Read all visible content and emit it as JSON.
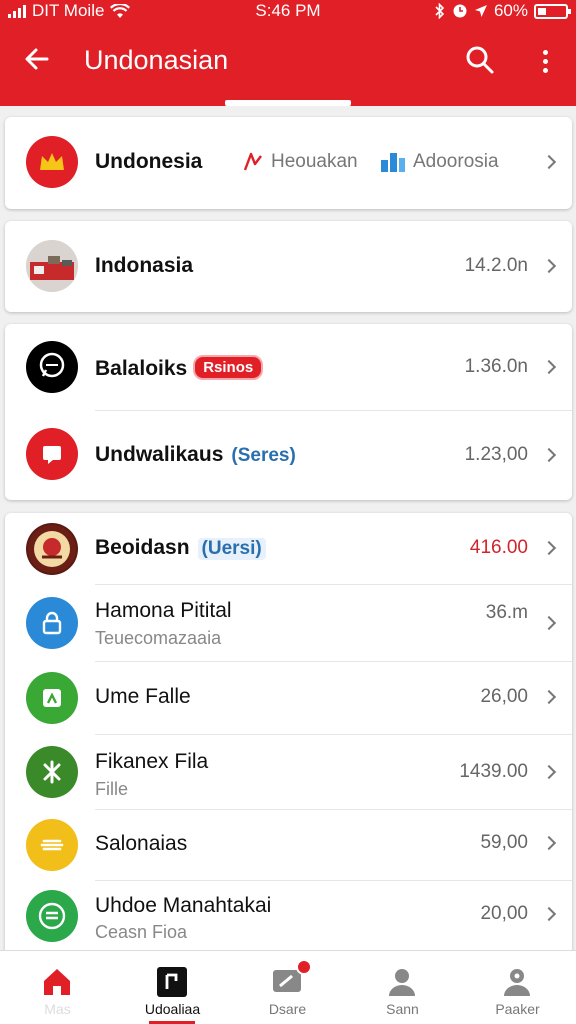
{
  "status": {
    "carrier": "DIT Moile",
    "time": "S:46 PM",
    "battery": "60%"
  },
  "appbar": {
    "title": "Undonasian"
  },
  "colors": {
    "primary": "#e01f27",
    "accent_blue": "#2b6fae",
    "price_red": "#d0242b"
  },
  "header_card": {
    "name": "Undonesia",
    "link1": "Heouakan",
    "link2": "Adoorosia"
  },
  "card1": {
    "name": "Indonasia",
    "value": "14.2.0n"
  },
  "card2": {
    "rows": [
      {
        "name": "Balaloiks",
        "pill": "Rsinos",
        "value": "1.36.0n"
      },
      {
        "name": "Undwalikaus",
        "tag": "(Seres)",
        "value": "1.23,00"
      }
    ]
  },
  "card3": {
    "rows": [
      {
        "name": "Beoidasn",
        "tag": "(Uersi)",
        "value": "416.00",
        "icon": "emblem-icon",
        "value_color": "#d0242b"
      },
      {
        "name": "Hamona Pitital",
        "sub": "Teuecomazaaia",
        "value": "36.m",
        "icon": "lock-icon"
      },
      {
        "name": "Ume Falle",
        "value": "26,00",
        "icon": "plant-icon"
      },
      {
        "name": "Fikanex Fila",
        "sub": "Fille",
        "value": "1439.00",
        "icon": "star-icon"
      },
      {
        "name": "Salonaias",
        "value": "59,00",
        "icon": "lines-icon"
      },
      {
        "name": "Uhdoe Manahtakai",
        "sub": "Ceasn Fioa",
        "value": "20,00",
        "icon": "list-circle-icon"
      }
    ]
  },
  "tabs": [
    {
      "label": "Mas",
      "icon": "home-icon"
    },
    {
      "label": "Udoaliaa",
      "icon": "screen-icon",
      "active": true
    },
    {
      "label": "Dsare",
      "icon": "message-icon"
    },
    {
      "label": "Sann",
      "icon": "person-icon"
    },
    {
      "label": "Paaker",
      "icon": "profile-icon"
    }
  ]
}
